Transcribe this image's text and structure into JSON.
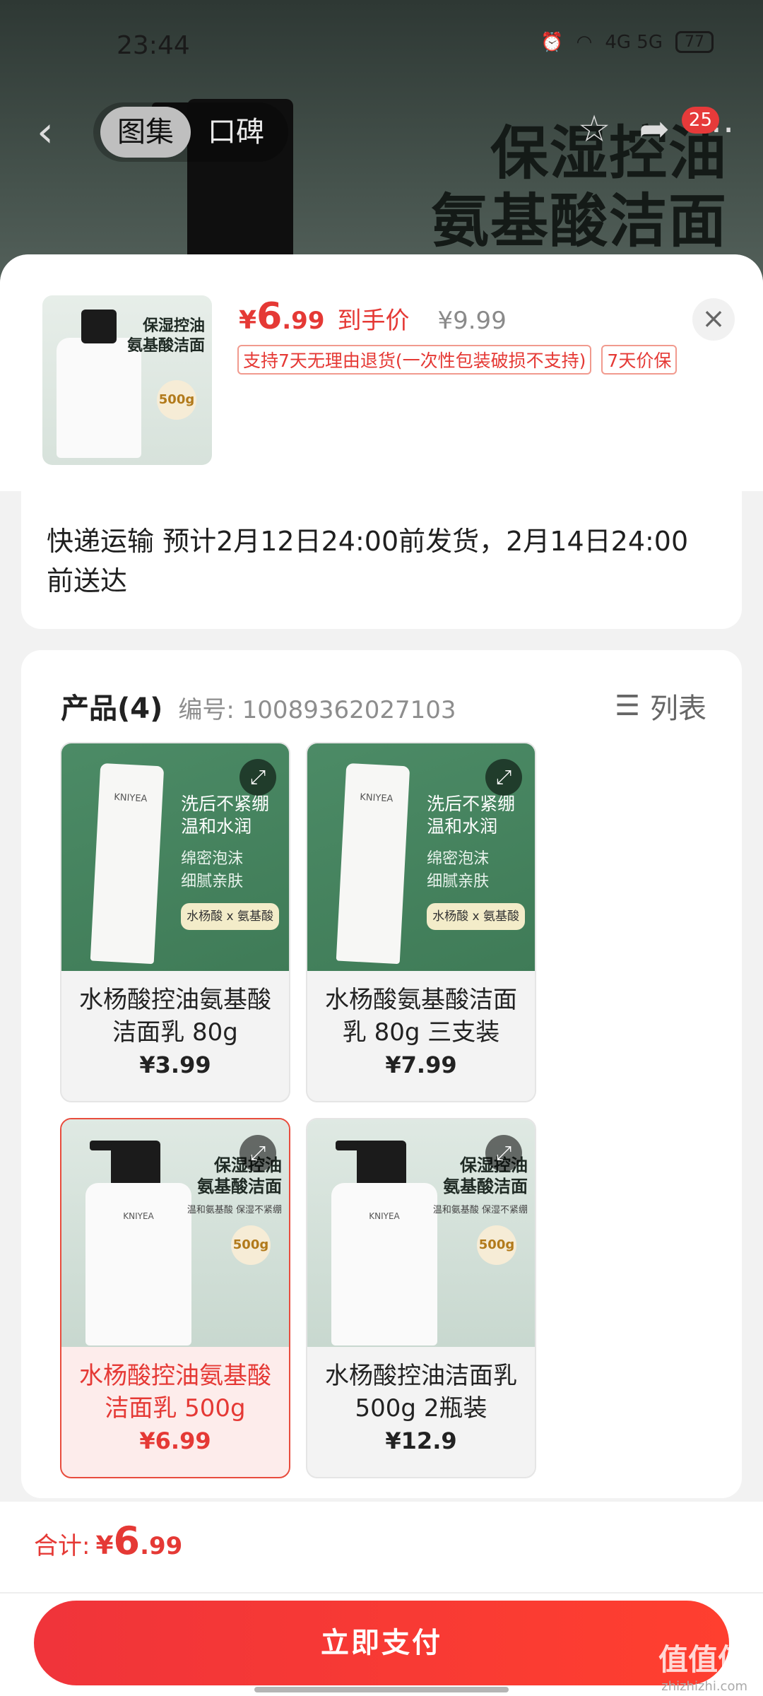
{
  "status_bar": {
    "time": "23:44",
    "network": "4G 5G",
    "battery": "77"
  },
  "nav": {
    "back": "‹",
    "tabs": [
      {
        "label": "图集"
      },
      {
        "label": "口碑"
      }
    ],
    "badge": "25",
    "icons": [
      "star-icon",
      "share-icon",
      "more-icon"
    ]
  },
  "background_banner": {
    "line1": "保湿控油",
    "line2": "氨基酸洁面"
  },
  "summary": {
    "price_currency": "¥",
    "price_int": "6",
    "price_dec": ".99",
    "price_label": "到手价",
    "original_price": "¥9.99",
    "tags": [
      "支持7天无理由退货(一次性包装破损不支持)",
      "7天价保"
    ],
    "close": "×",
    "thumb_text": {
      "line1": "保湿控油",
      "line2": "氨基酸洁面",
      "badge": "500g"
    }
  },
  "shipping": {
    "text": "快递运输 预计2月12日24:00前发货，2月14日24:00前送达"
  },
  "products": {
    "title": "产品(4)",
    "code_label": "编号: 10089362027103",
    "view_toggle": "列表",
    "items": [
      {
        "name": "水杨酸控油氨基酸洁面乳 80g",
        "price": "¥3.99",
        "selected": false,
        "img": {
          "l1": "洗后不紧绷",
          "l2": "温和水润",
          "l3": "绵密泡沫",
          "l4": "细腻亲肤",
          "tag": "水杨酸 x 氨基酸",
          "brand": "KNIYEA"
        }
      },
      {
        "name": "水杨酸氨基酸洁面乳 80g 三支装",
        "price": "¥7.99",
        "selected": false,
        "img": {
          "l1": "洗后不紧绷",
          "l2": "温和水润",
          "l3": "绵密泡沫",
          "l4": "细腻亲肤",
          "tag": "水杨酸 x 氨基酸",
          "brand": "KNIYEA"
        }
      },
      {
        "name": "水杨酸控油氨基酸洁面乳 500g",
        "price": "¥6.99",
        "selected": true,
        "img": {
          "l1": "保湿控油",
          "l2": "氨基酸洁面",
          "sub": "温和氨基酸 保湿不紧绷",
          "badge": "500g",
          "brand": "KNIYEA"
        }
      },
      {
        "name": "水杨酸控油洁面乳 500g 2瓶装",
        "price": "¥12.9",
        "selected": false,
        "img": {
          "l1": "保湿控油",
          "l2": "氨基酸洁面",
          "sub": "温和氨基酸 保湿不紧绷",
          "badge": "500g",
          "brand": "KNIYEA"
        }
      }
    ]
  },
  "footer": {
    "total_label": "合计:",
    "total_currency": "¥",
    "total_int": "6",
    "total_dec": ".99",
    "pay_button": "立即支付",
    "watermark": "值值值",
    "watermark_url": "zhizhizhi.com"
  },
  "colors": {
    "accent": "#e53935",
    "pay_button": "#f0343a",
    "product_green": "#4c8b66"
  }
}
